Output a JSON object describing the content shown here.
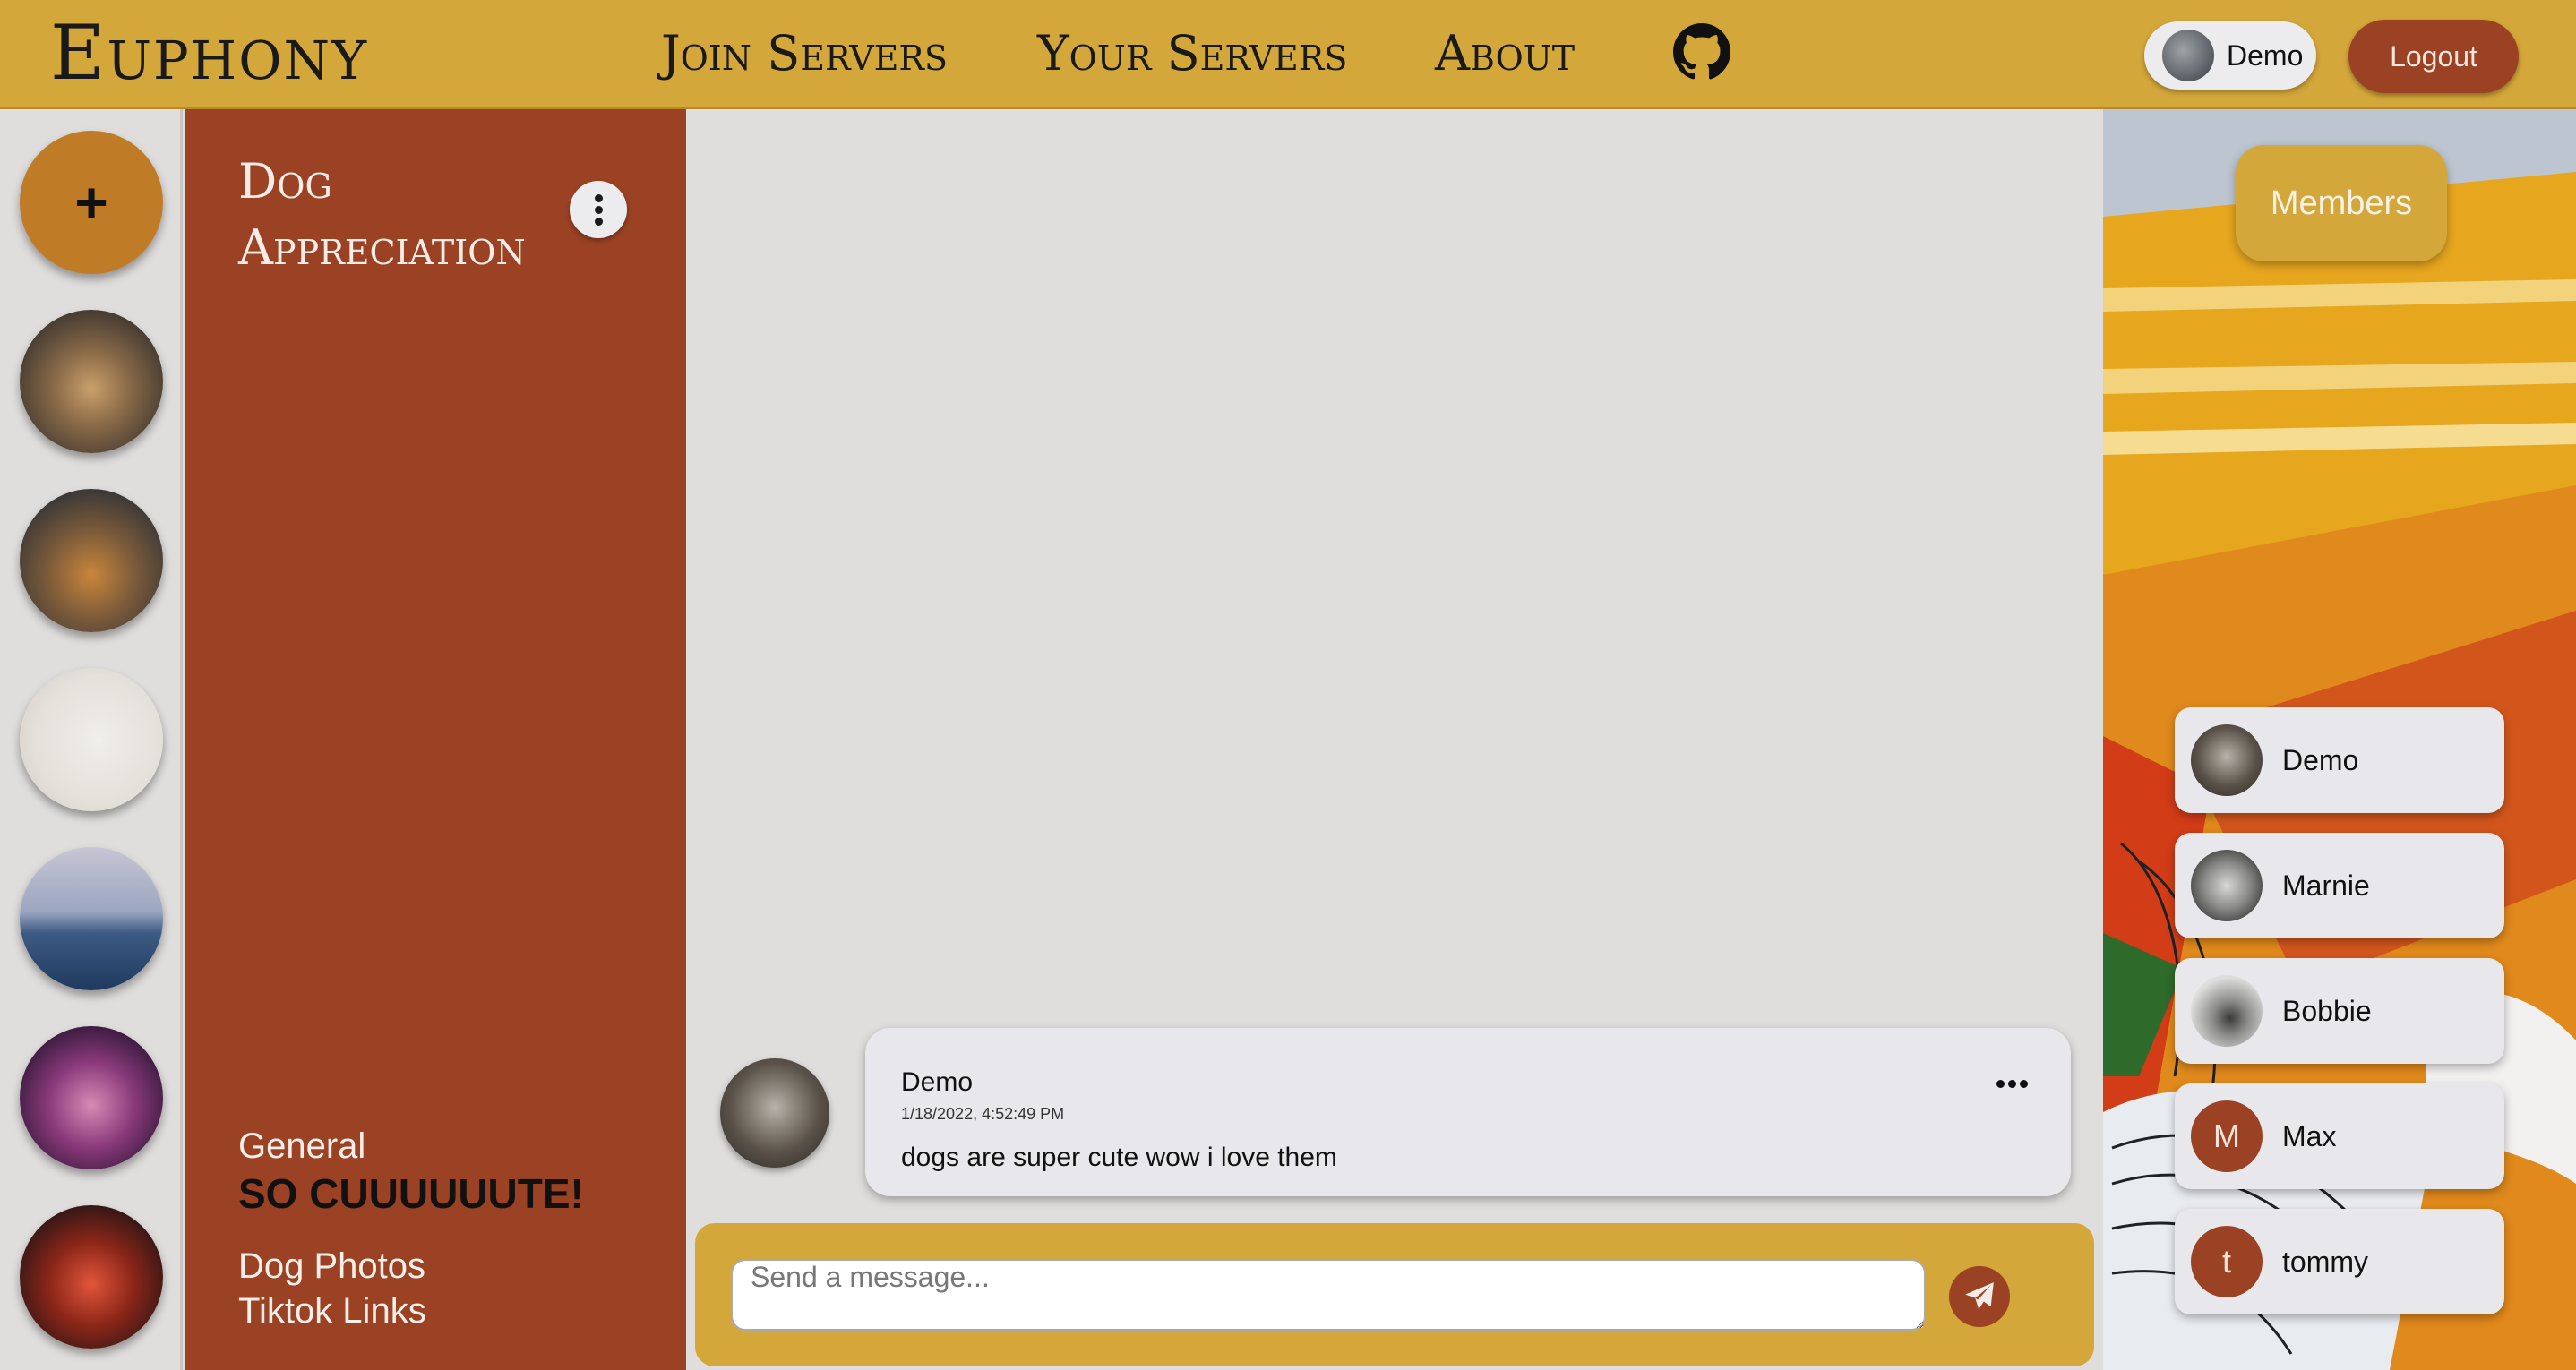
{
  "app": {
    "title": "Euphony"
  },
  "nav": {
    "links": [
      "Join Servers",
      "Your Servers",
      "About"
    ],
    "github_icon": "github-icon"
  },
  "user": {
    "name": "Demo",
    "logout_label": "Logout"
  },
  "rail": {
    "add_label": "+"
  },
  "server": {
    "name": "Dog Appreciation",
    "channels": [
      "General",
      "SO CUUUUUUTE!",
      "Dog Photos",
      "Tiktok Links"
    ],
    "active_channel_index": 1
  },
  "messages": [
    {
      "author": "Demo",
      "timestamp": "1/18/2022, 4:52:49 PM",
      "text": "dogs are super cute wow i love them"
    }
  ],
  "composer": {
    "placeholder": "Send a message...",
    "send_icon": "paper-plane-icon"
  },
  "members_panel": {
    "button_label": "Members",
    "members": [
      {
        "name": "Demo",
        "initial": ""
      },
      {
        "name": "Marnie",
        "initial": ""
      },
      {
        "name": "Bobbie",
        "initial": ""
      },
      {
        "name": "Max",
        "initial": "M"
      },
      {
        "name": "tommy",
        "initial": "t"
      }
    ]
  },
  "colors": {
    "gold": "#d4a73a",
    "rust": "#9b4224",
    "orange": "#c07b26",
    "background": "#e0dedc",
    "card": "#e8e8ec"
  }
}
